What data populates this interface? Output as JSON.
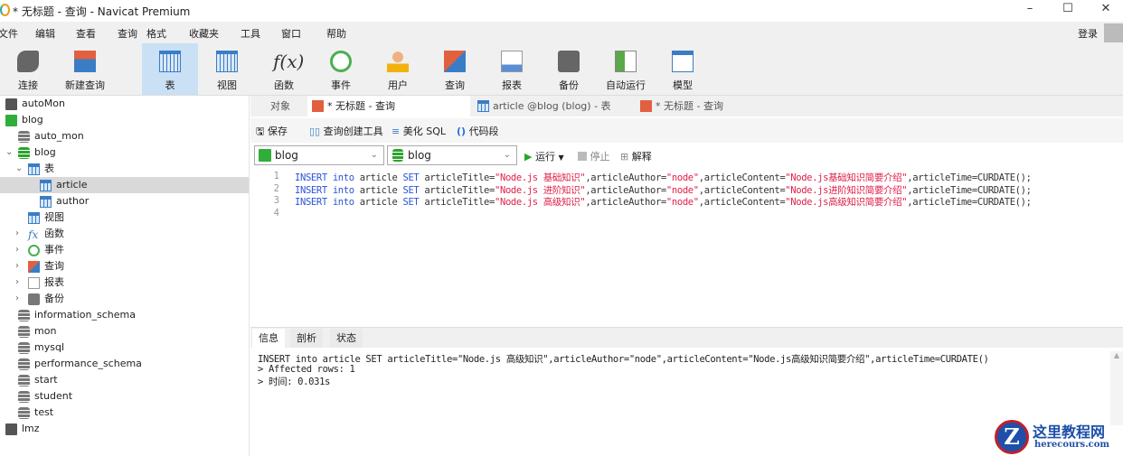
{
  "window": {
    "title": "* 无标题 - 查询 - Navicat Premium",
    "minimize": "–",
    "maximize": "☐",
    "close": "✕"
  },
  "menu": [
    "文件",
    "编辑",
    "查看",
    "查询",
    "格式",
    "收藏夹",
    "工具",
    "窗口",
    "帮助"
  ],
  "login": "登录",
  "toolbar": [
    {
      "label": "连接",
      "icon": "connect-icon"
    },
    {
      "label": "新建查询",
      "icon": "new-query-icon"
    },
    {
      "label": "表",
      "icon": "table-icon",
      "selected": true
    },
    {
      "label": "视图",
      "icon": "view-icon"
    },
    {
      "label": "函数",
      "icon": "function-icon"
    },
    {
      "label": "事件",
      "icon": "event-clock-icon"
    },
    {
      "label": "用户",
      "icon": "user-icon"
    },
    {
      "label": "查询",
      "icon": "query-icon"
    },
    {
      "label": "报表",
      "icon": "report-icon"
    },
    {
      "label": "备份",
      "icon": "backup-icon"
    },
    {
      "label": "自动运行",
      "icon": "auto-run-icon"
    },
    {
      "label": "模型",
      "icon": "model-icon"
    }
  ],
  "tree": [
    {
      "label": "autoMon",
      "type": "conn"
    },
    {
      "label": "blog",
      "type": "conn-active"
    },
    {
      "label": "auto_mon",
      "type": "db"
    },
    {
      "label": "blog",
      "type": "db-open",
      "arrow": "⌄"
    },
    {
      "label": "表",
      "type": "tables",
      "arrow": "⌄"
    },
    {
      "label": "article",
      "type": "table",
      "selected": true
    },
    {
      "label": "author",
      "type": "table"
    },
    {
      "label": "视图",
      "type": "views"
    },
    {
      "label": "函数",
      "type": "functions",
      "arrow": "›"
    },
    {
      "label": "事件",
      "type": "events",
      "arrow": "›"
    },
    {
      "label": "查询",
      "type": "queries",
      "arrow": "›"
    },
    {
      "label": "报表",
      "type": "reports",
      "arrow": "›"
    },
    {
      "label": "备份",
      "type": "backups",
      "arrow": "›"
    },
    {
      "label": "information_schema",
      "type": "db"
    },
    {
      "label": "mon",
      "type": "db"
    },
    {
      "label": "mysql",
      "type": "db"
    },
    {
      "label": "performance_schema",
      "type": "db"
    },
    {
      "label": "start",
      "type": "db"
    },
    {
      "label": "student",
      "type": "db"
    },
    {
      "label": "test",
      "type": "db"
    },
    {
      "label": "lmz",
      "type": "conn"
    }
  ],
  "tabs": {
    "objects": "对象",
    "t1": "* 无标题 - 查询",
    "t2": "article @blog (blog) - 表",
    "t3": "* 无标题 - 查询"
  },
  "qtoolbar": {
    "save": "保存",
    "builder": "查询创建工具",
    "beautify": "美化 SQL",
    "snippet": "代码段",
    "run": "运行",
    "stop": "停止",
    "explain": "解释"
  },
  "selectors": {
    "connection": "blog",
    "database": "blog"
  },
  "editor": {
    "lines": [
      [
        [
          "kw",
          "INSERT"
        ],
        [
          "pl",
          " "
        ],
        [
          "kw",
          "into"
        ],
        [
          "pl",
          " article "
        ],
        [
          "kw",
          "SET"
        ],
        [
          "pl",
          " articleTitle="
        ],
        [
          "str",
          "\"Node.js 基础知识\""
        ],
        [
          "pl",
          ",articleAuthor="
        ],
        [
          "str",
          "\"node\""
        ],
        [
          "pl",
          ",articleContent="
        ],
        [
          "str",
          "\"Node.js基础知识简要介绍\""
        ],
        [
          "pl",
          ",articleTime=CURDATE();"
        ]
      ],
      [
        [
          "kw",
          "INSERT"
        ],
        [
          "pl",
          " "
        ],
        [
          "kw",
          "into"
        ],
        [
          "pl",
          " article "
        ],
        [
          "kw",
          "SET"
        ],
        [
          "pl",
          " articleTitle="
        ],
        [
          "str",
          "\"Node.js 进阶知识\""
        ],
        [
          "pl",
          ",articleAuthor="
        ],
        [
          "str",
          "\"node\""
        ],
        [
          "pl",
          ",articleContent="
        ],
        [
          "str",
          "\"Node.js进阶知识简要介绍\""
        ],
        [
          "pl",
          ",articleTime=CURDATE();"
        ]
      ],
      [
        [
          "kw",
          "INSERT"
        ],
        [
          "pl",
          " "
        ],
        [
          "kw",
          "into"
        ],
        [
          "pl",
          " article "
        ],
        [
          "kw",
          "SET"
        ],
        [
          "pl",
          " articleTitle="
        ],
        [
          "str",
          "\"Node.js 高级知识\""
        ],
        [
          "pl",
          ",articleAuthor="
        ],
        [
          "str",
          "\"node\""
        ],
        [
          "pl",
          ",articleContent="
        ],
        [
          "str",
          "\"Node.js高级知识简要介绍\""
        ],
        [
          "pl",
          ",articleTime=CURDATE();"
        ]
      ],
      []
    ]
  },
  "result": {
    "tabs": [
      "信息",
      "剖析",
      "状态"
    ],
    "lines": [
      "INSERT into article SET articleTitle=\"Node.js 高级知识\",articleAuthor=\"node\",articleContent=\"Node.js高级知识简要介绍\",articleTime=CURDATE()",
      "> Affected rows: 1",
      "> 时间: 0.031s"
    ]
  },
  "watermark": {
    "name": "这里教程网",
    "url": "herecours.com"
  },
  "colors": {
    "keyword": "#2b54d6",
    "string": "#e0204a",
    "selected": "#c9e0f5"
  }
}
